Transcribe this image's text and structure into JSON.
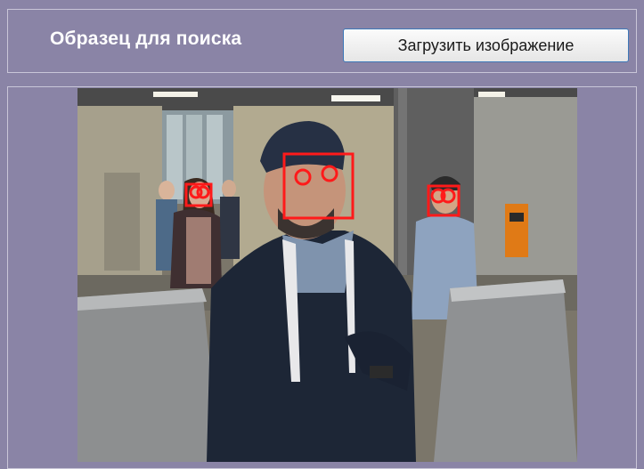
{
  "panel": {
    "search_label": "Образец для поиска",
    "load_button_label": "Загрузить изображение"
  },
  "colors": {
    "background": "#8a84a6",
    "detection_box": "#ff1a1a",
    "button_border": "#3d78b8"
  },
  "detections": [
    {
      "name": "face-detection-main-person"
    },
    {
      "name": "face-detection-left-person"
    },
    {
      "name": "face-detection-right-person"
    }
  ]
}
